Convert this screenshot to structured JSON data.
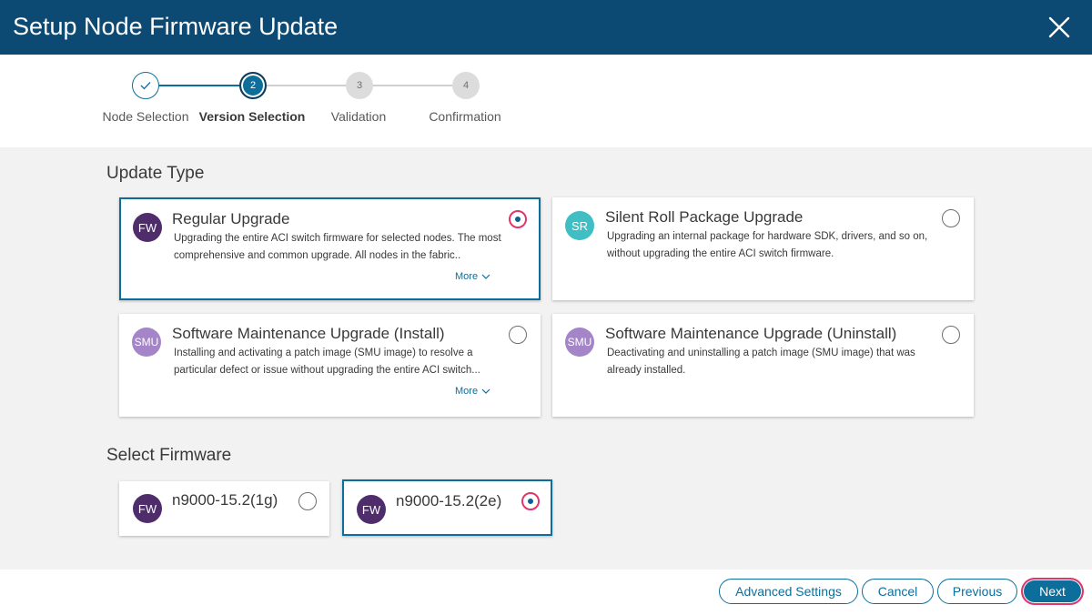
{
  "header": {
    "title": "Setup Node Firmware Update"
  },
  "stepper": {
    "steps": [
      {
        "number": "✓",
        "label": "Node Selection",
        "state": "done"
      },
      {
        "number": "2",
        "label": "Version Selection",
        "state": "active"
      },
      {
        "number": "3",
        "label": "Validation",
        "state": "pending"
      },
      {
        "number": "4",
        "label": "Confirmation",
        "state": "pending"
      }
    ]
  },
  "update_type": {
    "title": "Update Type",
    "options": [
      {
        "badge": "FW",
        "badge_color": "#4f2d6b",
        "title": "Regular Upgrade",
        "description": "Upgrading the entire ACI switch firmware for selected nodes. The most comprehensive and common upgrade. All nodes in the fabric..",
        "more": "More",
        "selected": true
      },
      {
        "badge": "SR",
        "badge_color": "#3fbfc4",
        "title": "Silent Roll Package Upgrade",
        "description": "Upgrading an internal package for hardware SDK, drivers, and so on, without upgrading the entire ACI switch firmware.",
        "more": "",
        "selected": false
      },
      {
        "badge": "SMU",
        "badge_color": "#a485c7",
        "title": "Software Maintenance Upgrade (Install)",
        "description": "Installing and activating a patch image (SMU image) to resolve a particular defect or issue without upgrading the entire ACI switch...",
        "more": "More",
        "selected": false
      },
      {
        "badge": "SMU",
        "badge_color": "#a485c7",
        "title": "Software Maintenance Upgrade (Uninstall)",
        "description": "Deactivating and uninstalling a patch image (SMU image) that was already installed.",
        "more": "",
        "selected": false
      }
    ]
  },
  "firmware": {
    "title": "Select Firmware",
    "options": [
      {
        "badge": "FW",
        "badge_color": "#4f2d6b",
        "version": "n9000-15.2(1g)",
        "selected": false
      },
      {
        "badge": "FW",
        "badge_color": "#4f2d6b",
        "version": "n9000-15.2(2e)",
        "selected": true
      }
    ]
  },
  "footer": {
    "advanced_label": "Advanced Settings",
    "cancel_label": "Cancel",
    "previous_label": "Previous",
    "next_label": "Next"
  },
  "colors": {
    "header_bg": "#0d4a73",
    "accent": "#0d6e9c",
    "focus_ring": "#e2366b",
    "page_bg": "#f2f2f2"
  }
}
